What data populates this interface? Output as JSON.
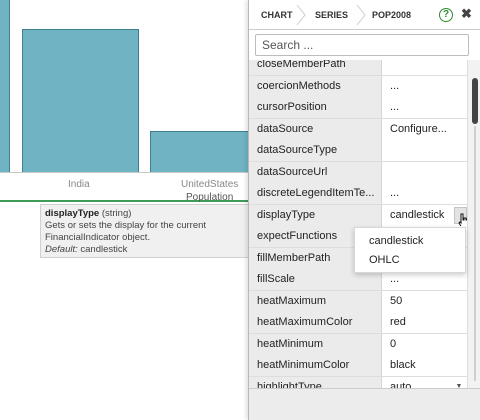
{
  "chart": {
    "categories": [
      "India",
      "UnitedStates"
    ],
    "axis_title": "Population",
    "colors": {
      "bar_fill": "#70b4c4",
      "bar_stroke": "#3d7f8f",
      "accent": "#3e9b5a"
    }
  },
  "tooltip": {
    "property": "displayType",
    "type": "(string)",
    "description": "Gets or sets the display for the current FinancialIndicator object.",
    "default_label": "Default:",
    "default_value": "candlestick"
  },
  "panel": {
    "breadcrumbs": [
      "CHART",
      "SERIES",
      "POP2008"
    ],
    "help_icon": "?",
    "close_icon": "✖",
    "search": {
      "placeholder": "Search ...",
      "value": ""
    },
    "properties": [
      {
        "name": "closeMemberPath",
        "value": ""
      },
      {
        "name": "coercionMethods",
        "value": "..."
      },
      {
        "name": "cursorPosition",
        "value": "..."
      },
      {
        "name": "dataSource",
        "value": "Configure..."
      },
      {
        "name": "dataSourceType",
        "value": ""
      },
      {
        "name": "dataSourceUrl",
        "value": ""
      },
      {
        "name": "discreteLegendItemTe...",
        "value": "..."
      },
      {
        "name": "displayType",
        "value": "candlestick"
      },
      {
        "name": "expectFunctions",
        "value": ""
      },
      {
        "name": "fillMemberPath",
        "value": ""
      },
      {
        "name": "fillScale",
        "value": "..."
      },
      {
        "name": "heatMaximum",
        "value": "50"
      },
      {
        "name": "heatMaximumColor",
        "value": "red"
      },
      {
        "name": "heatMinimum",
        "value": "0"
      },
      {
        "name": "heatMinimumColor",
        "value": "black"
      },
      {
        "name": "highlightType",
        "value": "auto"
      }
    ],
    "dropdown_options": [
      "candlestick",
      "OHLC"
    ]
  }
}
